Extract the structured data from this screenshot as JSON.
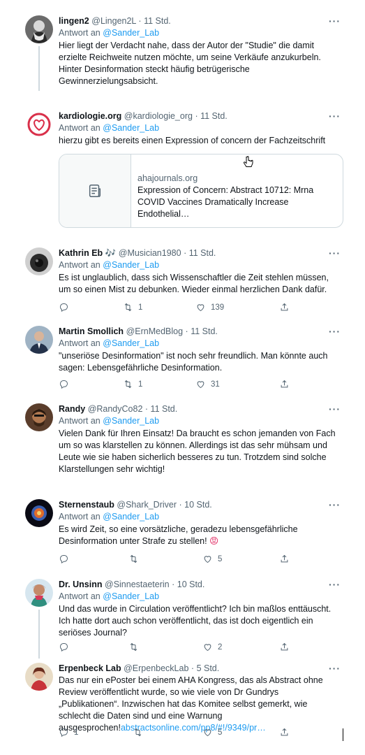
{
  "tweets": [
    {
      "name": "lingen2",
      "handle": "@Lingen2L",
      "time": "11 Std.",
      "reply_prefix": "Antwort an",
      "reply_to": "@Sander_Lab",
      "text": "Hier liegt der Verdacht nahe, dass der Autor der \"Studie\" die damit erzielte Reichweite nutzen möchte, um seine Verkäufe anzukurbeln.\nHinter Desinformation steckt häufig betrügerische Gewinnerzielungsabsicht."
    },
    {
      "name": "kardiologie.org",
      "handle": "@kardiologie_org",
      "time": "11 Std.",
      "reply_prefix": "Antwort an",
      "reply_to": "@Sander_Lab",
      "text": "hierzu gibt es bereits einen Expression of concern der Fachzeitschrift",
      "card": {
        "domain": "ahajournals.org",
        "title": "Expression of Concern: Abstract 10712: Mrna COVID Vaccines Dramatically Increase Endothelial…",
        "icon": "document-icon"
      }
    },
    {
      "name": "Kathrin Eb",
      "emoji": "🎶",
      "handle": "@Musician1980",
      "time": "11 Std.",
      "reply_prefix": "Antwort an",
      "reply_to": "@Sander_Lab",
      "text": "Es ist unglaublich, dass sich Wissenschaftler die Zeit stehlen müssen, um so einen Mist zu debunken. Wieder einmal herzlichen Dank dafür.",
      "retweets": "1",
      "likes": "139"
    },
    {
      "name": "Martin Smollich",
      "handle": "@ErnMedBlog",
      "time": "11 Std.",
      "reply_prefix": "Antwort an",
      "reply_to": "@Sander_Lab",
      "text": "\"unseriöse Desinformation\" ist noch sehr freundlich. Man könnte auch sagen: Lebensgefährliche Desinformation.",
      "retweets": "1",
      "likes": "31"
    },
    {
      "name": "Randy",
      "handle": "@RandyCo82",
      "time": "11 Std.",
      "reply_prefix": "Antwort an",
      "reply_to": "@Sander_Lab",
      "text": "Vielen Dank für Ihren Einsatz! Da braucht es schon jemanden von Fach um so was klarstellen zu können. Allerdings ist das sehr mühsam und Leute wie sie haben sicherlich besseres zu tun. Trotzdem sind solche Klarstellungen sehr wichtig!"
    },
    {
      "name": "Sternenstaub",
      "handle": "@Shark_Driver",
      "time": "10 Std.",
      "reply_prefix": "Antwort an",
      "reply_to": "@Sander_Lab",
      "text": "Es wird Zeit, so eine vorsätzliche, geradezu lebensgefährliche Desinformation unter Strafe zu stellen!",
      "text_emoji": "😡",
      "likes": "5"
    },
    {
      "name": "Dr. Unsinn",
      "handle": "@Sinnestaeterin",
      "time": "10 Std.",
      "reply_prefix": "Antwort an",
      "reply_to": "@Sander_Lab",
      "text": "Und das wurde in Circulation veröffentlicht? Ich bin maßlos enttäuscht. Ich hatte dort auch schon veröffentlicht, das ist doch eigentlich ein seriöses Journal?",
      "likes": "2"
    },
    {
      "name": "Erpenbeck Lab",
      "handle": "@ErpenbeckLab",
      "time": "5 Std.",
      "text": "Das nur ein ePoster bei einem AHA Kongress, das als Abstract ohne Review veröffentlicht wurde, so wie viele von Dr Gundrys „Publikationen“. Inzwischen hat das Komitee selbst gemerkt, wie schlecht die Daten sind und eine Warnung ausgesprochen!",
      "link": "abstractsonline.com/pp8/#!/9349/pr…",
      "replies": "1",
      "likes": "5"
    }
  ],
  "dot": "·",
  "more_glyph": "···"
}
